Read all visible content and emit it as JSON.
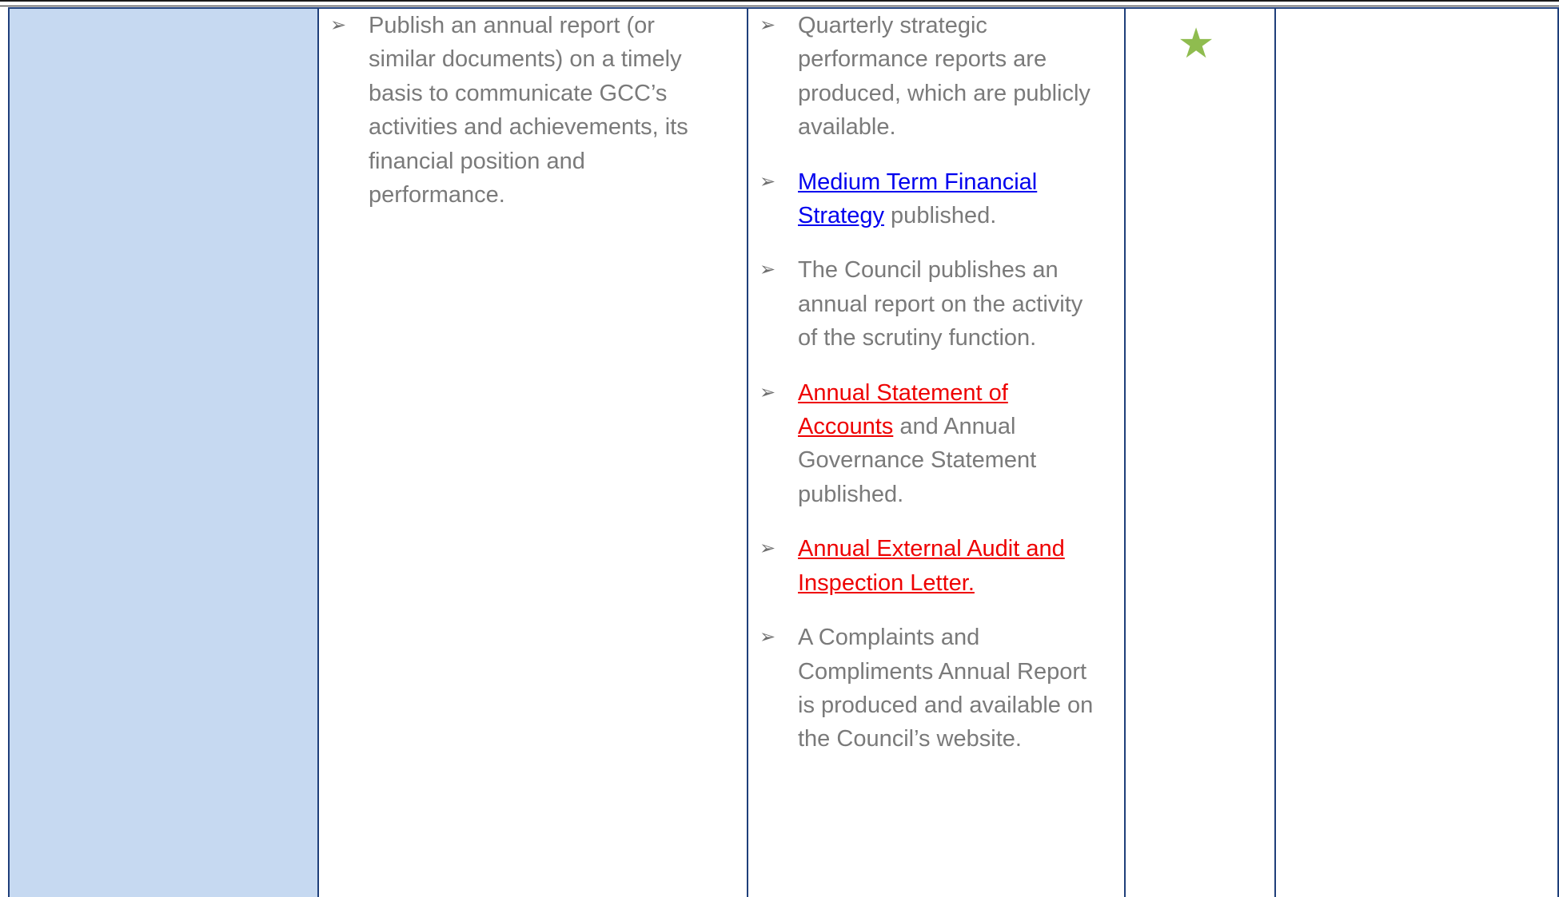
{
  "table": {
    "row": {
      "action_items": [
        "Publish an annual report (or similar documents) on a timely basis to communicate GCC’s activities and achievements, its financial position and performance."
      ],
      "evidence": {
        "item1_text": "Quarterly strategic performance reports are produced, which are publicly available.",
        "item2_link": "Medium Term Financial Strategy",
        "item2_suffix": " published.",
        "item3_text": "The Council publishes an annual report on the activity of the scrutiny function.",
        "item4_link": "Annual Statement of Accounts",
        "item4_suffix": " and Annual Governance Statement published.",
        "item5_link": "Annual External Audit and Inspection Letter.",
        "item6_text": "A Complaints and Compliments Annual Report is produced and available on the Council’s website."
      },
      "rating_icon": "star-icon",
      "rating_glyph": "★",
      "bullet_glyph": "➢"
    }
  },
  "colors": {
    "row_header_fill": "#c6d9f1",
    "border": "#1f3f7a",
    "body_text": "#7a7a7a",
    "link_blue": "#0000ee",
    "link_red": "#ee0000",
    "star": "#8fbc4f"
  }
}
